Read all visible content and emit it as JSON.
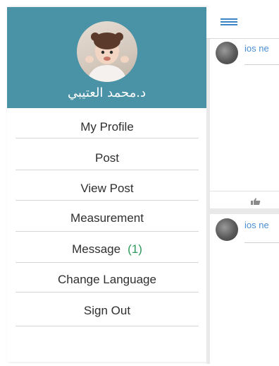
{
  "drawer": {
    "user_name": "د.محمد العتيبي",
    "menu": [
      {
        "id": "my-profile",
        "label": "My Profile"
      },
      {
        "id": "post",
        "label": "Post"
      },
      {
        "id": "view-post",
        "label": "View Post"
      },
      {
        "id": "measurement",
        "label": "Measurement"
      },
      {
        "id": "message",
        "label": "Message",
        "count": "(1)"
      },
      {
        "id": "change-language",
        "label": "Change Language"
      },
      {
        "id": "sign-out",
        "label": "Sign Out"
      }
    ]
  },
  "feed": {
    "posts": [
      {
        "author": "ios ne"
      },
      {
        "author": "ios ne"
      }
    ]
  },
  "colors": {
    "header_bg": "#4a92a6",
    "menu_accent": "#3d86c6",
    "link": "#4a8fd4",
    "badge": "#2e9a5c"
  },
  "icons": {
    "menu": "hamburger-icon",
    "like": "thumbs-up-icon"
  }
}
